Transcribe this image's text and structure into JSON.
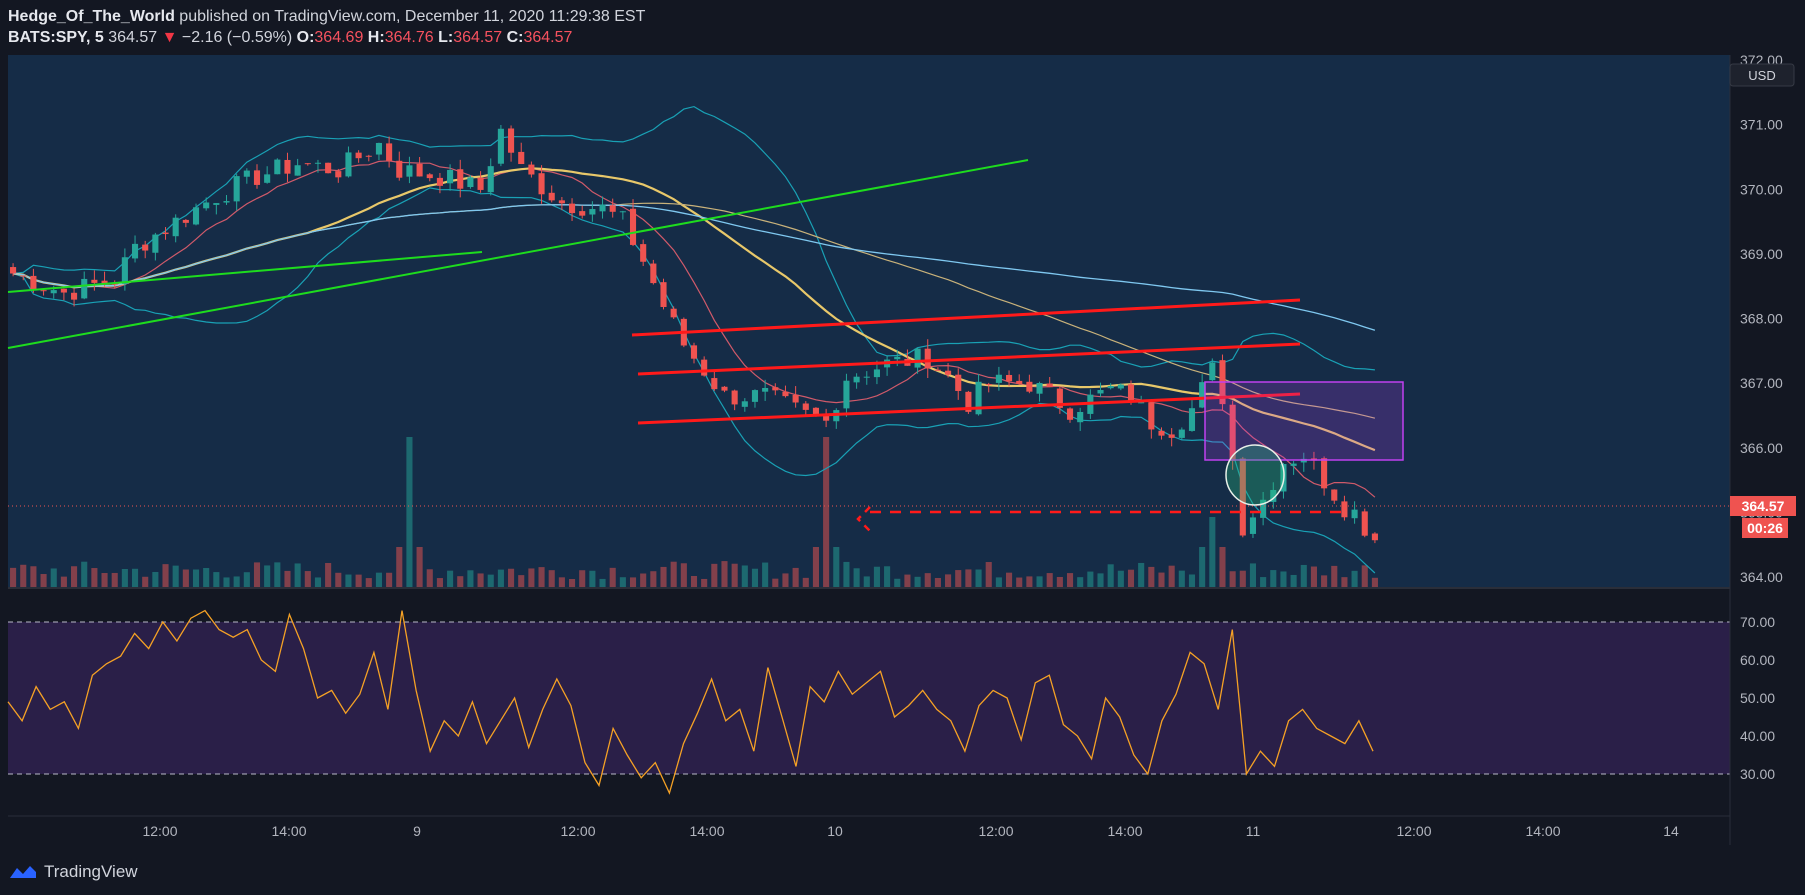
{
  "header": {
    "author": "Hedge_Of_The_World",
    "published": "published on TradingView.com, December 11, 2020 11:29:38 EST",
    "symbol": "BATS:SPY, 5",
    "last": "364.57",
    "change": "−2.16 (−0.59%)",
    "o_label": "O:",
    "o_value": "364.69",
    "h_label": "H:",
    "h_value": "364.76",
    "l_label": "L:",
    "l_value": "364.57",
    "c_label": "C:",
    "c_value": "364.57"
  },
  "price_axis": {
    "currency": "USD",
    "ticks": [
      "372.00",
      "371.00",
      "370.00",
      "369.00",
      "368.00",
      "367.00",
      "366.00",
      "365.00",
      "364.00"
    ],
    "last_price_label": "364.57",
    "countdown_label": "00:26"
  },
  "rsi_axis": {
    "ticks": [
      "70.00",
      "60.00",
      "50.00",
      "40.00",
      "30.00"
    ]
  },
  "time_axis": {
    "ticks": [
      "12:00",
      "14:00",
      "9",
      "12:00",
      "14:00",
      "10",
      "12:00",
      "14:00",
      "11",
      "12:00",
      "14:00",
      "14"
    ]
  },
  "footer": {
    "brand": "TradingView"
  },
  "colors": {
    "background": "#131722",
    "pane": "#152c47",
    "up": "#26a69a",
    "down": "#ef5350",
    "rsi_line": "#f5a125",
    "rsi_band": "#2a1f48",
    "channel": "#ff1a1a",
    "trendline": "#1edc1e",
    "bollinger": "#19a1b5",
    "ma_long": "#7fc8f0",
    "ma_mid": "#e8c86a",
    "box": "#b23be8"
  },
  "chart_data": [
    {
      "type": "candlestick",
      "symbol": "BATS:SPY",
      "interval": "5",
      "ylim": [
        363.8,
        372.0
      ],
      "x_ticks": [
        "12:00",
        "14:00",
        "9",
        "12:00",
        "14:00",
        "10",
        "12:00",
        "14:00",
        "11",
        "12:00",
        "14:00",
        "14"
      ],
      "close_path": [
        [
          0,
          368.7
        ],
        [
          5,
          368.4
        ],
        [
          10,
          368.6
        ],
        [
          12,
          369.1
        ],
        [
          16,
          369.5
        ],
        [
          20,
          369.9
        ],
        [
          24,
          370.2
        ],
        [
          28,
          370.4
        ],
        [
          32,
          370.3
        ],
        [
          36,
          370.7
        ],
        [
          38,
          370.3
        ],
        [
          42,
          370.2
        ],
        [
          46,
          370.0
        ],
        [
          48,
          370.9
        ],
        [
          50,
          370.3
        ],
        [
          54,
          369.8
        ],
        [
          58,
          369.7
        ],
        [
          60,
          369.5
        ],
        [
          62,
          368.9
        ],
        [
          64,
          368.2
        ],
        [
          66,
          367.6
        ],
        [
          68,
          367.2
        ],
        [
          70,
          366.8
        ],
        [
          74,
          366.8
        ],
        [
          78,
          366.5
        ],
        [
          80,
          366.4
        ],
        [
          82,
          367.1
        ],
        [
          86,
          367.3
        ],
        [
          90,
          367.4
        ],
        [
          92,
          367.1
        ],
        [
          94,
          366.7
        ],
        [
          96,
          367.0
        ],
        [
          100,
          367.0
        ],
        [
          104,
          366.6
        ],
        [
          108,
          366.9
        ],
        [
          110,
          366.8
        ],
        [
          112,
          366.4
        ],
        [
          114,
          366.3
        ],
        [
          116,
          366.6
        ],
        [
          118,
          367.2
        ],
        [
          119,
          366.8
        ],
        [
          121,
          364.8
        ],
        [
          123,
          365.2
        ],
        [
          125,
          365.8
        ],
        [
          127,
          365.9
        ],
        [
          129,
          365.5
        ],
        [
          131,
          365.1
        ],
        [
          132,
          365.0
        ],
        [
          134,
          364.57
        ]
      ],
      "last": 364.57,
      "volume_spikes": [
        [
          39,
          "high"
        ],
        [
          80,
          "high"
        ],
        [
          118,
          "medium"
        ]
      ],
      "indicators": [
        "Bollinger Bands",
        "Moving Average (short)",
        "Moving Average (medium)",
        "Moving Average (long)"
      ]
    },
    {
      "type": "line",
      "name": "RSI",
      "ylim": [
        25,
        75
      ],
      "bands": [
        30,
        70
      ],
      "values": [
        49,
        44,
        53,
        47,
        49,
        42,
        56,
        59,
        61,
        67,
        63,
        70,
        65,
        71,
        73,
        68,
        66,
        68,
        60,
        57,
        72,
        63,
        50,
        52,
        46,
        51,
        62,
        47,
        73,
        52,
        36,
        44,
        40,
        49,
        38,
        44,
        50,
        37,
        47,
        55,
        48,
        33,
        27,
        42,
        35,
        29,
        33,
        25,
        38,
        46,
        55,
        44,
        47,
        36,
        58,
        45,
        32,
        53,
        49,
        57,
        51,
        54,
        57,
        45,
        48,
        52,
        47,
        44,
        36,
        48,
        52,
        50,
        39,
        54,
        56,
        43,
        40,
        34,
        50,
        45,
        35,
        30,
        44,
        51,
        62,
        59,
        47,
        68,
        30,
        36,
        32,
        44,
        47,
        42,
        40,
        38,
        44,
        36
      ]
    }
  ]
}
